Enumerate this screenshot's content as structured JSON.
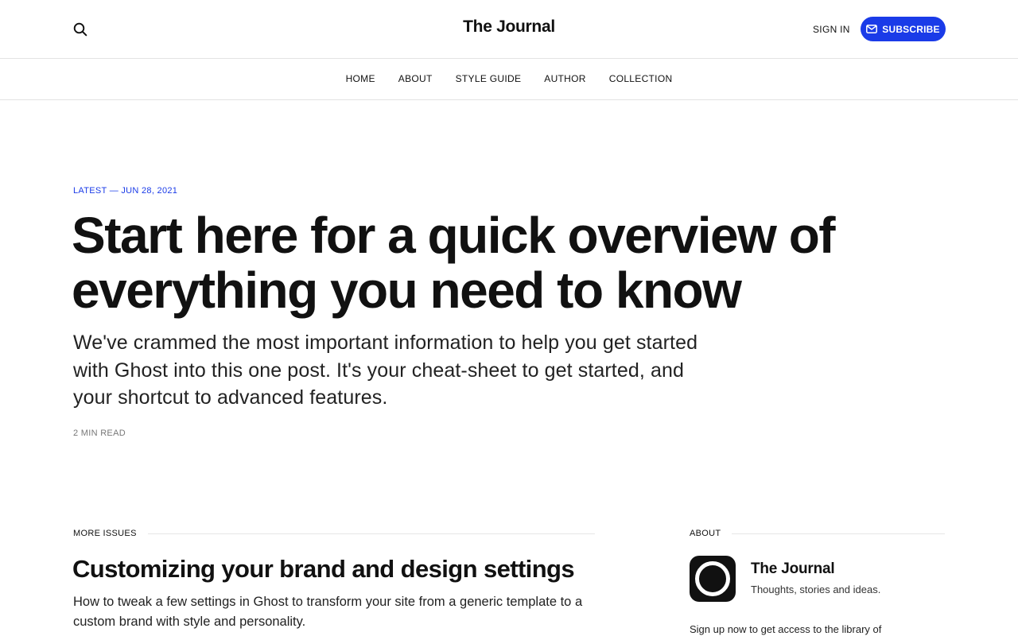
{
  "header": {
    "site_title": "The Journal",
    "sign_in": "SIGN IN",
    "subscribe": "SUBSCRIBE",
    "accent_color": "#1a3be8"
  },
  "nav": {
    "items": [
      {
        "label": "HOME"
      },
      {
        "label": "ABOUT"
      },
      {
        "label": "STYLE GUIDE"
      },
      {
        "label": "AUTHOR"
      },
      {
        "label": "COLLECTION"
      }
    ]
  },
  "hero": {
    "meta": "LATEST — JUN 28, 2021",
    "title": "Start here for a quick overview of everything you need to know",
    "excerpt": "We've crammed the most important information to help you get started with Ghost into this one post. It's your cheat-sheet to get started, and your shortcut to advanced features.",
    "read_time": "2 MIN READ"
  },
  "more_issues": {
    "heading": "MORE ISSUES",
    "post_title": "Customizing your brand and design settings",
    "post_excerpt": "How to tweak a few settings in Ghost to transform your site from a generic template to a custom brand with style and personality."
  },
  "about": {
    "heading": "ABOUT",
    "name": "The Journal",
    "description": "Thoughts, stories and ideas.",
    "signup_text": "Sign up now to get access to the library of"
  },
  "icons": {
    "search": "search-icon",
    "mail": "mail-icon",
    "logo": "logo-icon"
  }
}
